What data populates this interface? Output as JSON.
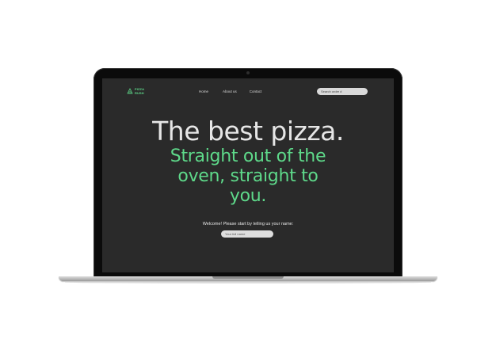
{
  "logo": {
    "line1": "PIZZA",
    "line2": "RUSH",
    "icon": "pizza-slice-icon"
  },
  "nav": {
    "links": [
      "Home",
      "About us",
      "Contact"
    ]
  },
  "search": {
    "placeholder": "Search order #"
  },
  "hero": {
    "title": "The best pizza.",
    "subtitle": "Straight out of the oven, straight to you."
  },
  "welcome": {
    "text": "Welcome! Please start by telling us your name:",
    "input_placeholder": "Your full name"
  },
  "colors": {
    "accent": "#5ed98a",
    "background": "#2a2a2a",
    "text": "#e6e6e6"
  }
}
